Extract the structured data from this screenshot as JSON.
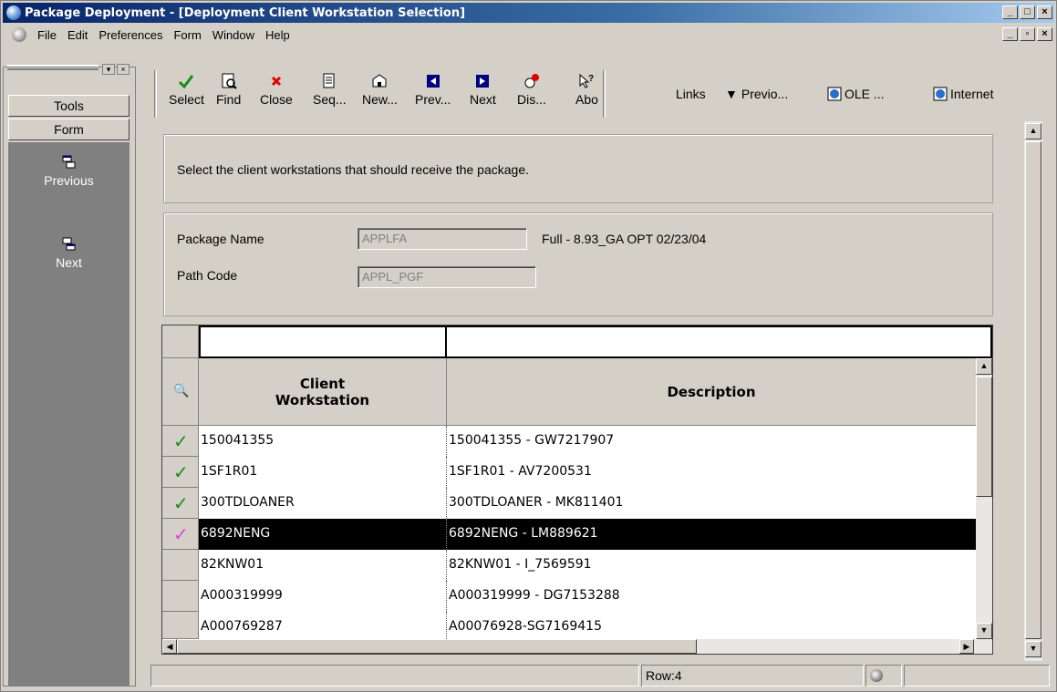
{
  "window": {
    "title": "Package Deployment - [Deployment Client Workstation Selection]"
  },
  "menu": {
    "items": [
      "File",
      "Edit",
      "Preferences",
      "Form",
      "Window",
      "Help"
    ]
  },
  "left_panel": {
    "tools_label": "Tools",
    "form_label": "Form",
    "items": [
      {
        "label": "Previous",
        "icon": "previous-icon"
      },
      {
        "label": "Next",
        "icon": "next-icon"
      }
    ]
  },
  "toolbar": {
    "buttons": [
      {
        "label": "Select",
        "icon": "check-icon"
      },
      {
        "label": "Find",
        "icon": "find-icon"
      },
      {
        "label": "Close",
        "icon": "close-icon"
      },
      {
        "label": "Seq...",
        "icon": "sequence-icon"
      },
      {
        "label": "New...",
        "icon": "new-icon"
      },
      {
        "label": "Prev...",
        "icon": "prev-icon"
      },
      {
        "label": "Next",
        "icon": "next-icon"
      },
      {
        "label": "Dis...",
        "icon": "display-icon"
      },
      {
        "label": "Abo",
        "icon": "about-icon"
      }
    ],
    "links_label": "Links",
    "links": [
      {
        "label": "Previo...",
        "icon": "dropdown-arrow-icon"
      },
      {
        "label": "OLE ...",
        "icon": "ole-icon"
      },
      {
        "label": "Internet",
        "icon": "internet-icon"
      }
    ]
  },
  "instructions": "Select the client workstations that should receive the package.",
  "form": {
    "package_name_label": "Package Name",
    "package_name_value": "APPLFA",
    "package_description": "Full - 8.93_GA OPT 02/23/04",
    "path_code_label": "Path Code",
    "path_code_value": "APPL_PGF"
  },
  "grid": {
    "headers": {
      "client_workstation": "Client\nWorkstation",
      "description": "Description"
    },
    "rows": [
      {
        "checked": true,
        "workstation": "150041355",
        "description": "150041355 - GW7217907"
      },
      {
        "checked": true,
        "workstation": "1SF1R01",
        "description": "1SF1R01 - AV7200531"
      },
      {
        "checked": true,
        "workstation": "300TDLOANER",
        "description": "300TDLOANER - MK811401"
      },
      {
        "checked": true,
        "selected": true,
        "workstation": "6892NENG",
        "description": "6892NENG - LM889621"
      },
      {
        "checked": false,
        "workstation": "82KNW01",
        "description": "82KNW01 - I_7569591"
      },
      {
        "checked": false,
        "workstation": "A000319999",
        "description": "A000319999 - DG7153288"
      },
      {
        "checked": false,
        "workstation": "A000769287",
        "description": "A00076928-SG7169415"
      }
    ]
  },
  "status": {
    "row": "Row:4"
  },
  "colors": {
    "check_green": "#1a8c1a",
    "check_pink": "#e040e0",
    "selection": "#000000",
    "title_gradient_start": "#0a246a"
  }
}
